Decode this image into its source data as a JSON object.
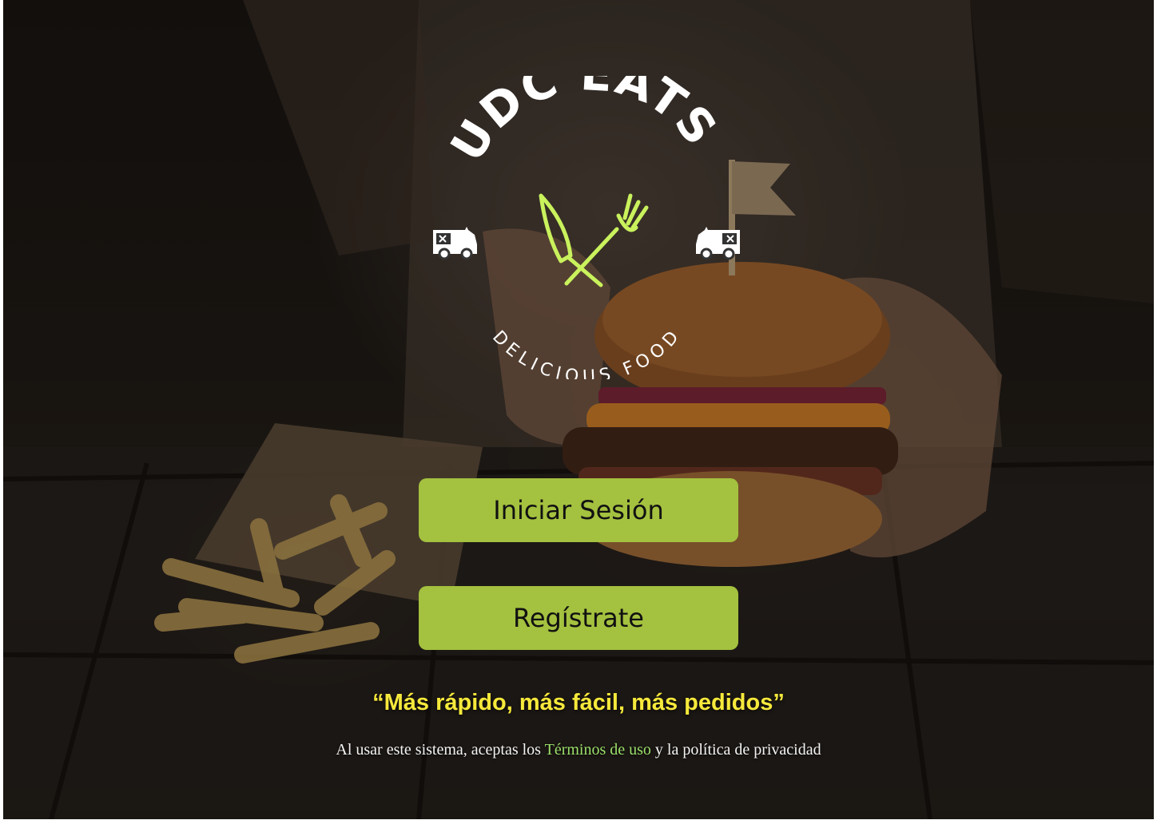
{
  "logo": {
    "brand": "UDC EATS",
    "subtitle": "DELICIOUS FOOD",
    "icons": [
      "food-truck-icon",
      "knife-fork-icon",
      "food-truck-icon"
    ],
    "colors": {
      "text": "#ffffff",
      "accent": "#c9f25c"
    }
  },
  "buttons": {
    "login_label": "Iniciar Sesión",
    "register_label": "Regístrate",
    "color": "#a4c13f"
  },
  "tagline": "“Más rápido, más fácil, más pedidos”",
  "legal": {
    "prefix": "Al usar este sistema, aceptas los",
    "terms_link": "Términos de uso",
    "suffix": "y la política de privacidad"
  }
}
